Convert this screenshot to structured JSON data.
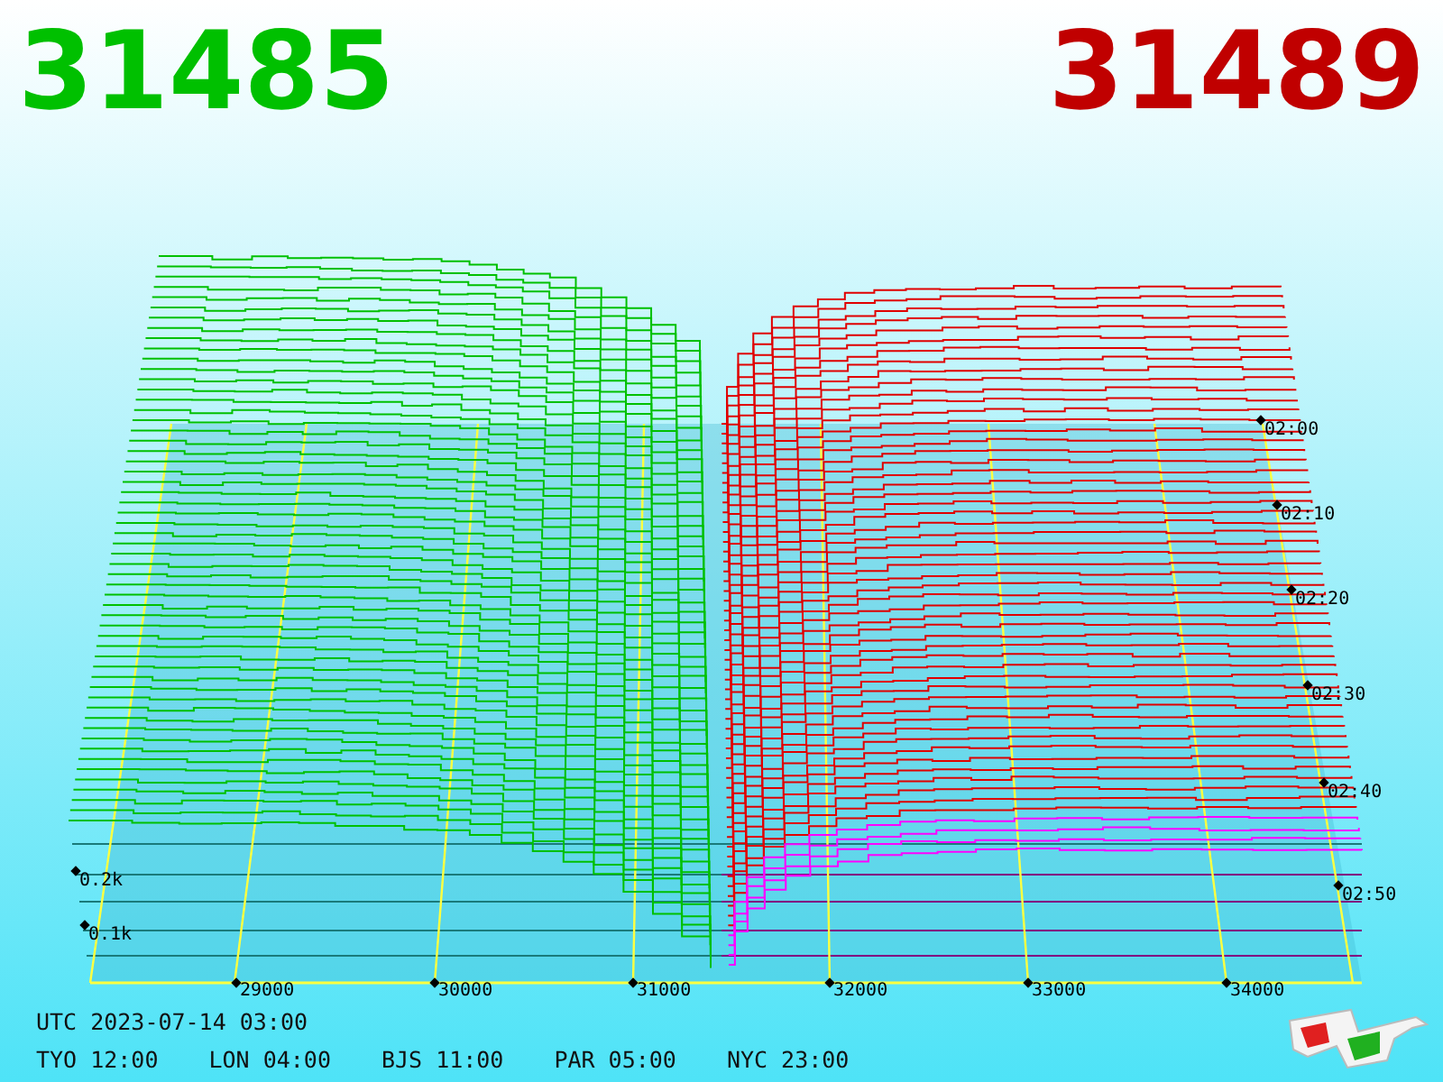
{
  "bid_price": "31485",
  "ask_price": "31489",
  "depth_labels": [
    "0.2k",
    "0.1k"
  ],
  "price_labels": [
    "29000",
    "30000",
    "31000",
    "32000",
    "33000",
    "34000"
  ],
  "time_labels": [
    "02:00",
    "02:10",
    "02:20",
    "02:30",
    "02:40",
    "02:50"
  ],
  "utc_time": "UTC 2023-07-14 03:00",
  "cities": [
    "TYO 12:00",
    "LON 04:00",
    "BJS 11:00",
    "PAR 05:00",
    "NYC 23:00"
  ]
}
